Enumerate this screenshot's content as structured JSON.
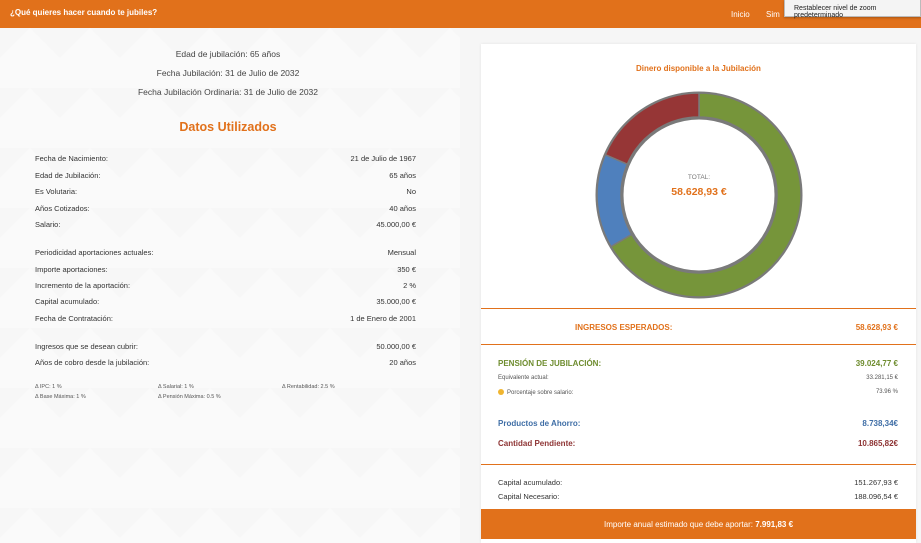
{
  "header": {
    "brand": "¿Qué quieres hacer cuando te jubiles?",
    "nav": [
      "Inicio",
      "Sim"
    ],
    "zoom_tooltip": "Restablecer nivel de zoom predeterminado"
  },
  "summary": {
    "edad": "Edad de jubilación: 65 años",
    "fecha": "Fecha Jubilación: 31 de Julio de 2032",
    "fecha_ordinaria": "Fecha Jubilación Ordinaria: 31 de Julio de 2032"
  },
  "datos": {
    "title": "Datos Utilizados",
    "group1": [
      {
        "label": "Fecha de Nacimiento:",
        "value": "21 de Julio de 1967"
      },
      {
        "label": "Edad de Jubilación:",
        "value": "65 años"
      },
      {
        "label": "Es Volutaria:",
        "value": "No"
      },
      {
        "label": "Años Cotizados:",
        "value": "40 años"
      },
      {
        "label": "Salario:",
        "value": "45.000,00 €"
      }
    ],
    "group2": [
      {
        "label": "Periodicidad aportaciones actuales:",
        "value": "Mensual"
      },
      {
        "label": "Importe aportaciones:",
        "value": "350 €"
      },
      {
        "label": "Incremento de la aportación:",
        "value": "2 %"
      },
      {
        "label": "Capital acumulado:",
        "value": "35.000,00 €"
      },
      {
        "label": "Fecha de Contratación:",
        "value": "1 de Enero de 2001"
      }
    ],
    "group3": [
      {
        "label": "Ingresos que se desean cubrir:",
        "value": "50.000,00 €"
      },
      {
        "label": "Años de cobro desde la jubilación:",
        "value": "20 años"
      }
    ],
    "fine": {
      "ipc": "Δ IPC: 1 %",
      "salarial": "Δ Salarial: 1 %",
      "rentabilidad": "Δ Rentabilidad: 2.5 %",
      "base": "Δ Base Máxima: 1 %",
      "pension": "Δ Pensión Máxima: 0.5 %"
    }
  },
  "panel": {
    "chart_title": "Dinero disponible a la Jubilación",
    "total_label": "TOTAL:",
    "total_value": "58.628,93 €",
    "ingresos_label": "INGRESOS ESPERADOS:",
    "ingresos_value": "58.628,93 €",
    "pension_label": "PENSIÓN DE JUBILACIÓN:",
    "pension_value": "39.024,77 €",
    "equivalente_label": "Equivalente actual:",
    "equivalente_value": "33.281,15 €",
    "porcentaje_label": "Porcentaje sobre salario:",
    "porcentaje_value": "73.96 %",
    "productos_label": "Productos de Ahorro:",
    "productos_value": "8.738,34€",
    "pendiente_label": "Cantidad Pendiente:",
    "pendiente_value": "10.865,82€",
    "capital_acum_label": "Capital acumulado:",
    "capital_acum_value": "151.267,93 €",
    "capital_nec_label": "Capital Necesario:",
    "capital_nec_value": "188.096,54 €",
    "bottom_text": "Importe anual estimado que debe aportar:",
    "bottom_value": "7.991,83 €"
  },
  "colors": {
    "accent": "#e1711b",
    "pension": "#76953a",
    "productos": "#4f80bd",
    "pendiente": "#963636"
  },
  "donut": {
    "segments": [
      {
        "key": "pension",
        "value": 39024.77,
        "color": "#76953a"
      },
      {
        "key": "productos",
        "value": 8738.34,
        "color": "#4f80bd"
      },
      {
        "key": "pendiente",
        "value": 10865.82,
        "color": "#963636"
      }
    ]
  }
}
